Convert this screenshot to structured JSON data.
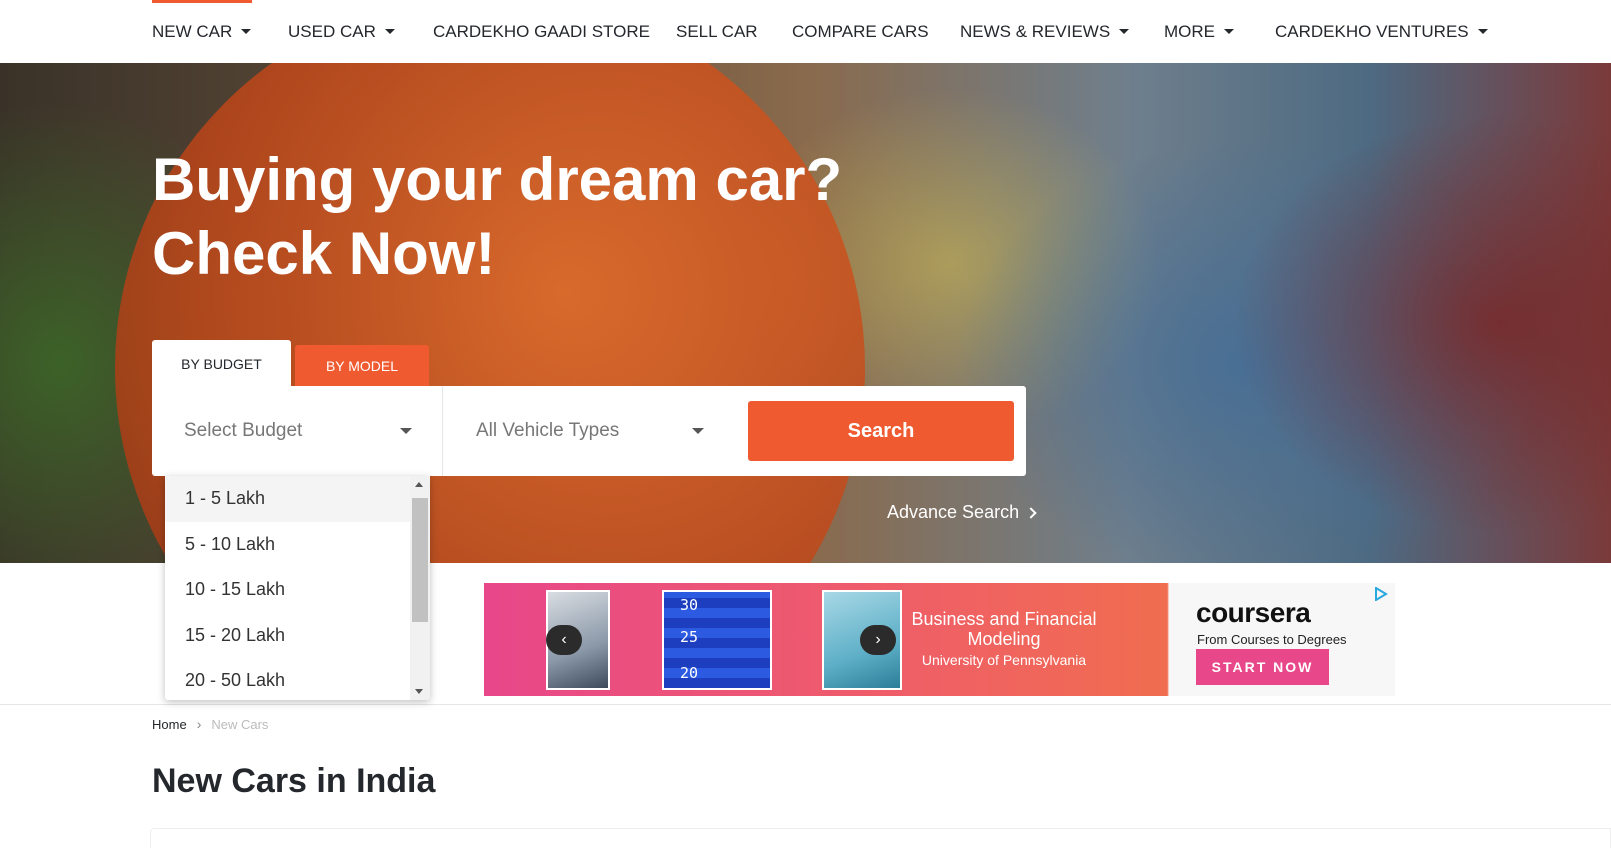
{
  "nav": {
    "items": [
      {
        "label": "NEW CAR",
        "dropdown": true
      },
      {
        "label": "USED CAR",
        "dropdown": true
      },
      {
        "label": "CARDEKHO GAADI STORE",
        "dropdown": false
      },
      {
        "label": "SELL CAR",
        "dropdown": false
      },
      {
        "label": "COMPARE CARS",
        "dropdown": false
      },
      {
        "label": "NEWS & REVIEWS",
        "dropdown": true
      },
      {
        "label": "MORE",
        "dropdown": true
      },
      {
        "label": "CARDEKHO VENTURES",
        "dropdown": true
      }
    ],
    "accent_color": "#ef5a30"
  },
  "hero": {
    "title_line1": "Buying your dream car?",
    "title_line2": "Check Now!"
  },
  "search": {
    "tabs": [
      {
        "label": "BY BUDGET",
        "active": true
      },
      {
        "label": "BY MODEL",
        "active": false
      }
    ],
    "budget_placeholder": "Select Budget",
    "vehicle_placeholder": "All Vehicle Types",
    "search_label": "Search",
    "advance_label": "Advance Search",
    "budget_options": [
      "1 - 5 Lakh",
      "5 - 10 Lakh",
      "10 - 15 Lakh",
      "15 - 20 Lakh",
      "20 - 50 Lakh"
    ],
    "highlighted_option": "1 - 5 Lakh"
  },
  "ad": {
    "course_title": "Business and Financial Modeling",
    "institution": "University of Pennsylvania",
    "brand": "coursera",
    "tagline": "From Courses to Degrees",
    "cta": "START NOW",
    "ticker_numbers": [
      "30",
      "25",
      "20"
    ]
  },
  "breadcrumb": {
    "home": "Home",
    "current": "New Cars"
  },
  "page_title": "New Cars in India"
}
